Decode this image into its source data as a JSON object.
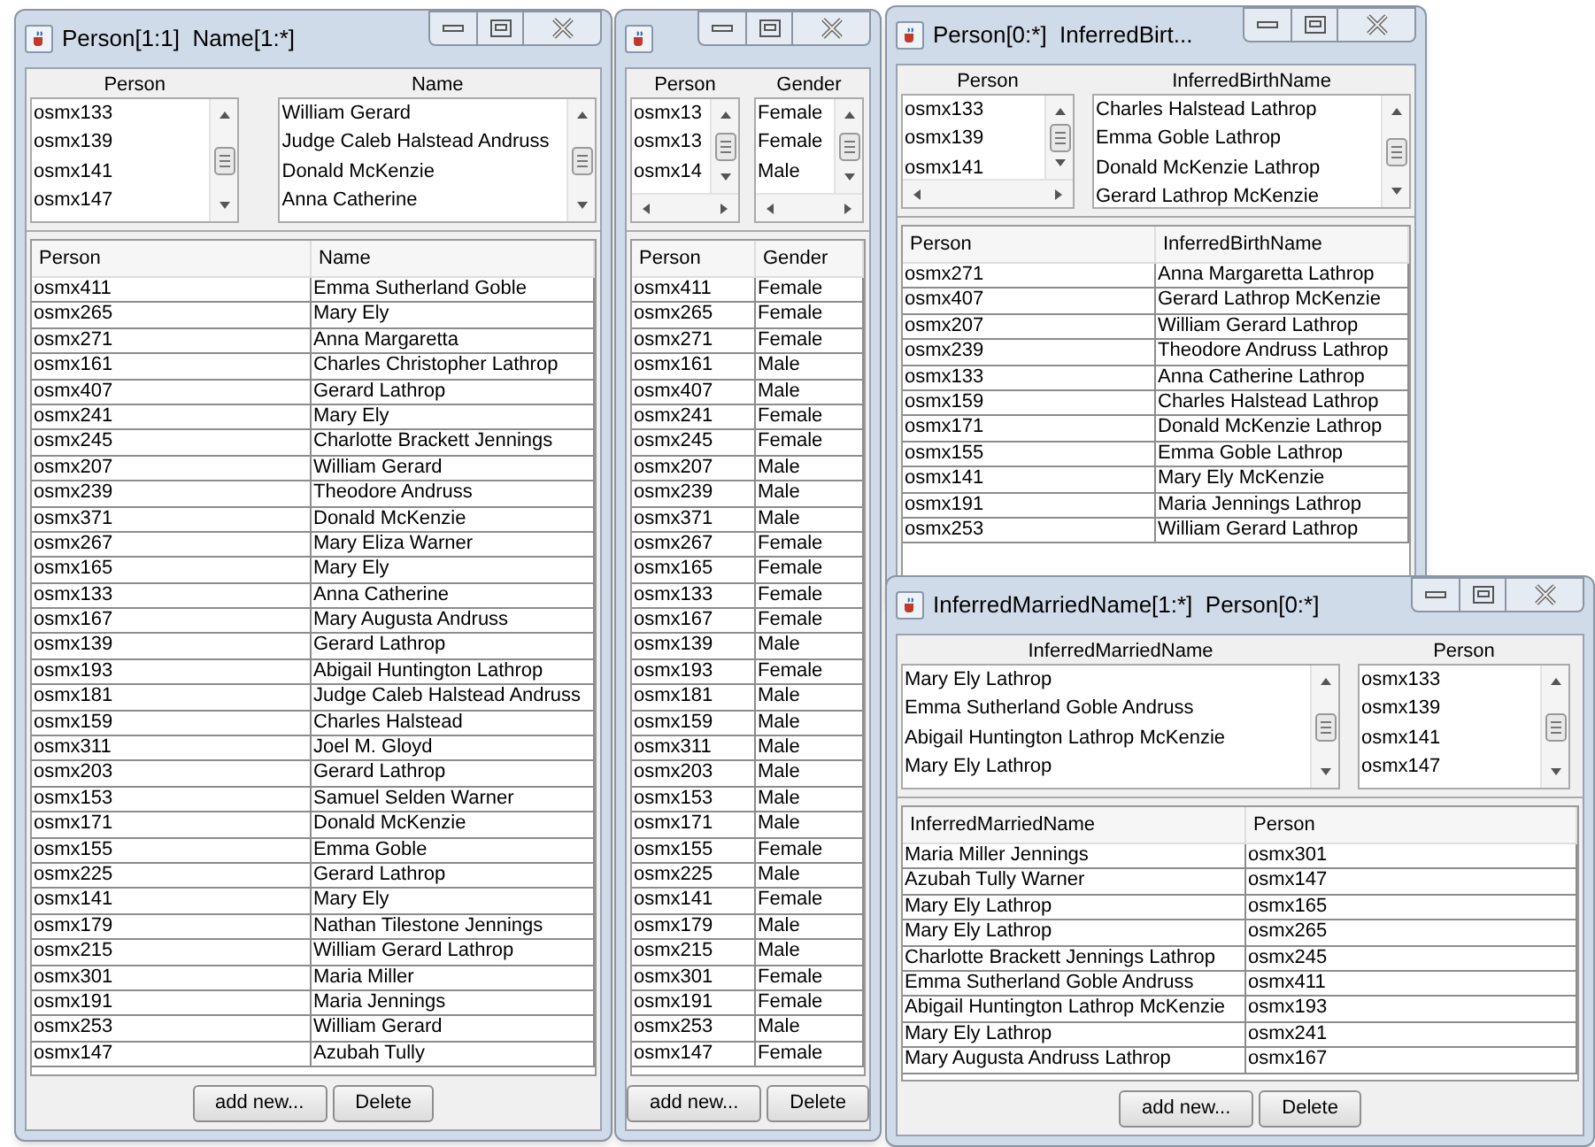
{
  "windows": [
    {
      "title": "Person[1:1]  Name[1:*]",
      "lists": [
        {
          "header": "Person",
          "items": [
            "osmx133",
            "osmx139",
            "osmx141",
            "osmx147"
          ]
        },
        {
          "header": "Name",
          "items": [
            "William Gerard",
            "Judge Caleb Halstead Andruss",
            "Donald McKenzie",
            "Anna Catherine"
          ]
        }
      ],
      "table": {
        "columns": [
          "Person",
          "Name"
        ],
        "rows": [
          [
            "osmx411",
            "Emma Sutherland Goble"
          ],
          [
            "osmx265",
            "Mary Ely"
          ],
          [
            "osmx271",
            "Anna Margaretta"
          ],
          [
            "osmx161",
            "Charles Christopher Lathrop"
          ],
          [
            "osmx407",
            "Gerard Lathrop"
          ],
          [
            "osmx241",
            "Mary Ely"
          ],
          [
            "osmx245",
            "Charlotte Brackett Jennings"
          ],
          [
            "osmx207",
            "William Gerard"
          ],
          [
            "osmx239",
            "Theodore Andruss"
          ],
          [
            "osmx371",
            "Donald McKenzie"
          ],
          [
            "osmx267",
            "Mary Eliza Warner"
          ],
          [
            "osmx165",
            "Mary Ely"
          ],
          [
            "osmx133",
            "Anna Catherine"
          ],
          [
            "osmx167",
            "Mary Augusta Andruss"
          ],
          [
            "osmx139",
            "Gerard Lathrop"
          ],
          [
            "osmx193",
            "Abigail Huntington Lathrop"
          ],
          [
            "osmx181",
            "Judge Caleb Halstead Andruss"
          ],
          [
            "osmx159",
            "Charles Halstead"
          ],
          [
            "osmx311",
            "Joel M. Gloyd"
          ],
          [
            "osmx203",
            "Gerard Lathrop"
          ],
          [
            "osmx153",
            "Samuel Selden Warner"
          ],
          [
            "osmx171",
            "Donald McKenzie"
          ],
          [
            "osmx155",
            "Emma Goble"
          ],
          [
            "osmx225",
            "Gerard Lathrop"
          ],
          [
            "osmx141",
            "Mary Ely"
          ],
          [
            "osmx179",
            "Nathan Tilestone Jennings"
          ],
          [
            "osmx215",
            "William Gerard Lathrop"
          ],
          [
            "osmx301",
            "Maria Miller"
          ],
          [
            "osmx191",
            "Maria Jennings"
          ],
          [
            "osmx253",
            "William Gerard"
          ],
          [
            "osmx147",
            "Azubah Tully"
          ]
        ]
      },
      "buttons": [
        "add new...",
        "Delete"
      ]
    },
    {
      "lists": [
        {
          "header": "Person",
          "items": [
            "osmx13",
            "osmx13",
            "osmx14"
          ]
        },
        {
          "header": "Gender",
          "items": [
            "Female",
            "Female",
            "Male"
          ]
        }
      ],
      "table": {
        "columns": [
          "Person",
          "Gender"
        ],
        "rows": [
          [
            "osmx411",
            "Female"
          ],
          [
            "osmx265",
            "Female"
          ],
          [
            "osmx271",
            "Female"
          ],
          [
            "osmx161",
            "Male"
          ],
          [
            "osmx407",
            "Male"
          ],
          [
            "osmx241",
            "Female"
          ],
          [
            "osmx245",
            "Female"
          ],
          [
            "osmx207",
            "Male"
          ],
          [
            "osmx239",
            "Male"
          ],
          [
            "osmx371",
            "Male"
          ],
          [
            "osmx267",
            "Female"
          ],
          [
            "osmx165",
            "Female"
          ],
          [
            "osmx133",
            "Female"
          ],
          [
            "osmx167",
            "Female"
          ],
          [
            "osmx139",
            "Male"
          ],
          [
            "osmx193",
            "Female"
          ],
          [
            "osmx181",
            "Male"
          ],
          [
            "osmx159",
            "Male"
          ],
          [
            "osmx311",
            "Male"
          ],
          [
            "osmx203",
            "Male"
          ],
          [
            "osmx153",
            "Male"
          ],
          [
            "osmx171",
            "Male"
          ],
          [
            "osmx155",
            "Female"
          ],
          [
            "osmx225",
            "Male"
          ],
          [
            "osmx141",
            "Female"
          ],
          [
            "osmx179",
            "Male"
          ],
          [
            "osmx215",
            "Male"
          ],
          [
            "osmx301",
            "Female"
          ],
          [
            "osmx191",
            "Female"
          ],
          [
            "osmx253",
            "Male"
          ],
          [
            "osmx147",
            "Female"
          ]
        ]
      },
      "buttons": [
        "add new...",
        "Delete"
      ]
    },
    {
      "title": "Person[0:*]  InferredBirt...",
      "lists": [
        {
          "header": "Person",
          "items": [
            "osmx133",
            "osmx139",
            "osmx141"
          ]
        },
        {
          "header": "InferredBirthName",
          "items": [
            "Charles Halstead Lathrop",
            "Emma Goble Lathrop",
            "Donald McKenzie Lathrop",
            "Gerard Lathrop McKenzie"
          ]
        }
      ],
      "table": {
        "columns": [
          "Person",
          "InferredBirthName"
        ],
        "rows": [
          [
            "osmx271",
            "Anna Margaretta Lathrop"
          ],
          [
            "osmx407",
            "Gerard Lathrop McKenzie"
          ],
          [
            "osmx207",
            "William Gerard Lathrop"
          ],
          [
            "osmx239",
            "Theodore Andruss Lathrop"
          ],
          [
            "osmx133",
            "Anna Catherine Lathrop"
          ],
          [
            "osmx159",
            "Charles Halstead Lathrop"
          ],
          [
            "osmx171",
            "Donald McKenzie Lathrop"
          ],
          [
            "osmx155",
            "Emma Goble Lathrop"
          ],
          [
            "osmx141",
            "Mary Ely McKenzie"
          ],
          [
            "osmx191",
            "Maria Jennings Lathrop"
          ],
          [
            "osmx253",
            "William Gerard Lathrop"
          ]
        ]
      }
    },
    {
      "title": "InferredMarriedName[1:*]  Person[0:*]",
      "lists": [
        {
          "header": "InferredMarriedName",
          "items": [
            "Mary Ely Lathrop",
            "Emma Sutherland Goble Andruss",
            "Abigail Huntington Lathrop McKenzie",
            "Mary Ely Lathrop"
          ]
        },
        {
          "header": "Person",
          "items": [
            "osmx133",
            "osmx139",
            "osmx141",
            "osmx147"
          ]
        }
      ],
      "table": {
        "columns": [
          "InferredMarriedName",
          "Person"
        ],
        "rows": [
          [
            "Maria Miller Jennings",
            "osmx301"
          ],
          [
            "Azubah Tully Warner",
            "osmx147"
          ],
          [
            "Mary Ely Lathrop",
            "osmx165"
          ],
          [
            "Mary Ely Lathrop",
            "osmx265"
          ],
          [
            "Charlotte Brackett Jennings Lathrop",
            "osmx245"
          ],
          [
            "Emma Sutherland Goble Andruss",
            "osmx411"
          ],
          [
            "Abigail Huntington Lathrop McKenzie",
            "osmx193"
          ],
          [
            "Mary Ely Lathrop",
            "osmx241"
          ],
          [
            "Mary Augusta Andruss Lathrop",
            "osmx167"
          ]
        ]
      },
      "buttons": [
        "add new...",
        "Delete"
      ]
    }
  ]
}
